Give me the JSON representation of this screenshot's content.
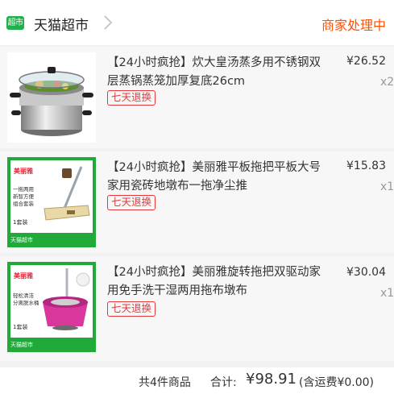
{
  "header": {
    "store_icon_text": "超市",
    "store_name": "天猫超市",
    "status": "商家处理中"
  },
  "items": [
    {
      "title": "【24小时疯抢】炊大皇汤蒸多用不锈钢双层蒸锅蒸笼加厚复底26cm",
      "tag": "七天退换",
      "price": "¥26.52",
      "qty": "x2"
    },
    {
      "title": "【24小时疯抢】美丽雅平板拖把平板大号家用瓷砖地墩布一拖净尘推",
      "tag": "七天退换",
      "price": "¥15.83",
      "qty": "x1",
      "image": {
        "brand": "美丽雅",
        "text_lines": [
          "一拖两用",
          "新智方便",
          "组合套装"
        ],
        "badge": "1套装",
        "footer": "天猫超市"
      }
    },
    {
      "title": "【24小时疯抢】美丽雅旋转拖把双驱动家用免手洗干湿两用拖布墩布",
      "tag": "七天退换",
      "price": "¥30.04",
      "qty": "x1",
      "image": {
        "brand": "美丽雅",
        "text_lines": [
          "轻松清洁",
          "分离脱水桶"
        ],
        "badge": "1套装",
        "footer": "天猫超市"
      }
    }
  ],
  "footer": {
    "count": "共4件商品",
    "total_label": "合计:",
    "total": "¥98.91",
    "shipping": "(含运费¥0.00)"
  },
  "colors": {
    "accent": "#ff5000",
    "tag_red": "#e4393c",
    "tmall_green": "#21b14a"
  }
}
